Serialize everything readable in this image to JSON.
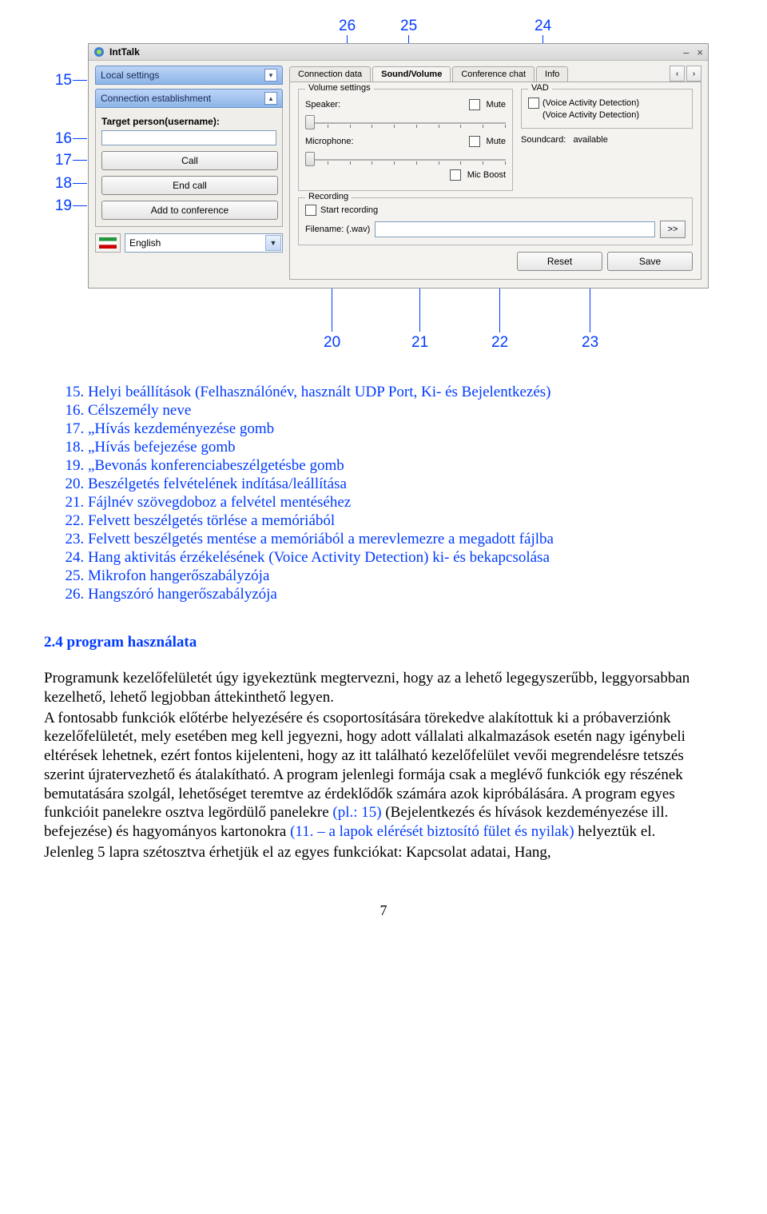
{
  "callouts": {
    "left": {
      "n15": "15",
      "n16": "16",
      "n17": "17",
      "n18": "18",
      "n19": "19"
    },
    "top": {
      "n26": "26",
      "n25": "25",
      "n24": "24"
    },
    "bottom": {
      "n20": "20",
      "n21": "21",
      "n22": "22",
      "n23": "23"
    }
  },
  "window": {
    "title": "IntTalk",
    "left_panel": {
      "header": "Local settings",
      "sub_header": "Connection establishment",
      "target_label": "Target person(username):",
      "call": "Call",
      "endcall": "End call",
      "addconf": "Add to conference",
      "lang_value": "English"
    },
    "tabs": {
      "t1": "Connection data",
      "t2": "Sound/Volume",
      "t3": "Conference chat",
      "t4": "Info"
    },
    "volume": {
      "legend": "Volume settings",
      "speaker": "Speaker:",
      "mic": "Microphone:",
      "mute": "Mute",
      "micboost": "Mic Boost"
    },
    "vad": {
      "legend": "VAD",
      "line1": "(Voice Activity Detection)",
      "line2": "(Voice Activity Detection)",
      "sound_label": "Soundcard:",
      "sound_val": "available"
    },
    "rec": {
      "legend": "Recording",
      "start": "Start recording",
      "fname": "Filename: (.wav)",
      "more": ">>",
      "reset": "Reset",
      "save": "Save"
    }
  },
  "list": {
    "i15": "Helyi beállítások (Felhasználónév, használt UDP Port, Ki- és Bejelentkezés)",
    "i16": "Célszemély neve",
    "i17": "„Hívás kezdeményezése gomb",
    "i18": "„Hívás befejezése gomb",
    "i19": "„Bevonás konferenciabeszélgetésbe gomb",
    "i20": "Beszélgetés felvételének indítása/leállítása",
    "i21": "Fájlnév szövegdoboz a felvétel mentéséhez",
    "i22": "Felvett beszélgetés törlése a memóriából",
    "i23": "Felvett beszélgetés mentése a memóriából a merevlemezre a megadott fájlba",
    "i24": "Hang aktivitás érzékelésének (Voice Activity Detection) ki- és bekapcsolása",
    "i25": "Mikrofon hangerőszabályzója",
    "i26": "Hangszóró hangerőszabályzója"
  },
  "section_heading": "2.4 program használata",
  "para1": "Programunk kezelőfelületét úgy igyekeztünk megtervezni, hogy az a lehető legegyszerűbb, leggyorsabban kezelhető, lehető legjobban áttekinthető legyen.",
  "para2a": "A fontosabb funkciók előtérbe helyezésére és csoportosítására törekedve alakítottuk ki a próbaverziónk kezelőfelületét, mely esetében meg kell jegyezni, hogy adott vállalati alkalmazások esetén nagy igénybeli eltérések lehetnek, ezért fontos kijelenteni, hogy az itt található kezelőfelület vevői megrendelésre tetszés szerint újratervezhető és átalakítható. A program jelenlegi formája csak a meglévő funkciók egy részének bemutatására szolgál, lehetőséget teremtve az érdeklődők számára azok kipróbálására. A program egyes funkcióit panelekre osztva legördülő panelekre ",
  "para2ref": "(pl.: 15)",
  "para2b": " (Bejelentkezés és hívások kezdeményezése ill. befejezése) és hagyományos kartonokra ",
  "para2c": "(11. – a lapok elérését biztosító fület és nyilak)",
  "para2d": " helyeztük el.",
  "para3": "Jelenleg 5 lapra szétosztva érhetjük el az egyes funkciókat: Kapcsolat adatai, Hang,",
  "pagenum": "7"
}
